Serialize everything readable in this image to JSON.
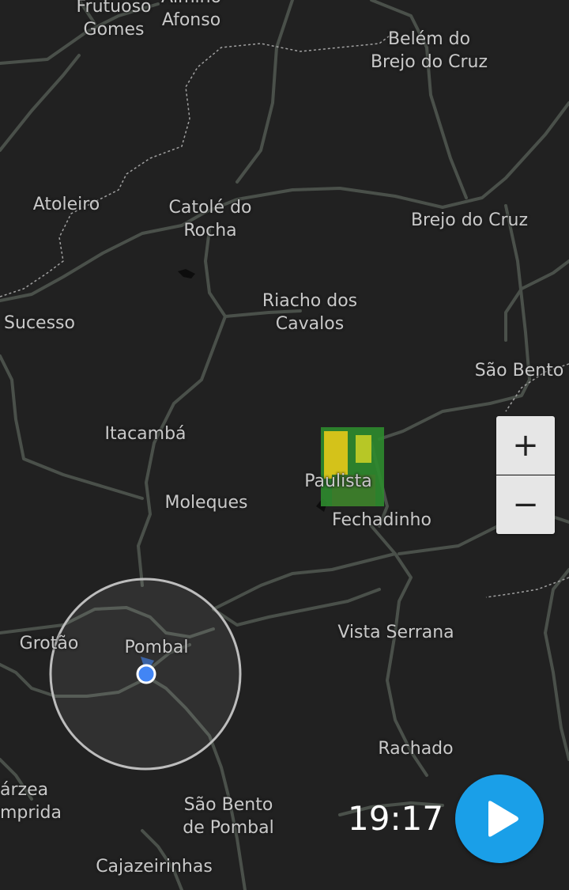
{
  "map": {
    "places": {
      "frutuoso_gomes": [
        "Frutuoso",
        "Gomes"
      ],
      "almino_afonso": [
        "Almino",
        "Afonso"
      ],
      "belem_do_brejo_do_cruz": [
        "Belém do",
        "Brejo do Cruz"
      ],
      "atoleiro": [
        "Atoleiro"
      ],
      "catole_do_rocha": [
        "Catolé do",
        "Rocha"
      ],
      "brejo_do_cruz": [
        "Brejo do Cruz"
      ],
      "riacho_dos_cavalos": [
        "Riacho dos",
        "Cavalos"
      ],
      "sucesso": [
        "Sucesso"
      ],
      "sao_bento": [
        "São Bento"
      ],
      "itacamba": [
        "Itacambá"
      ],
      "paulista": [
        "Paulista"
      ],
      "moleques": [
        "Moleques"
      ],
      "fechadinho": [
        "Fechadinho"
      ],
      "vista_serrana": [
        "Vista Serrana"
      ],
      "grotao": [
        "Grotão"
      ],
      "pombal": [
        "Pombal"
      ],
      "rachado": [
        "Rachado"
      ],
      "varzea_comprida": [
        "árzea",
        "mprida"
      ],
      "sao_bento_de_pombal": [
        "São Bento",
        "de Pombal"
      ],
      "cajazeirinhas": [
        "Cajazeirinhas"
      ]
    },
    "location_marker": {
      "color": "#4285f4"
    }
  },
  "controls": {
    "zoom_in": "+",
    "zoom_out": "−",
    "time": "19:17",
    "play_icon": "play-icon"
  },
  "colors": {
    "background": "#212121",
    "road": "#4a504a",
    "border": "#bdbdbd",
    "accent": "#1a9fe8",
    "radar_green": "#2e8b2e",
    "radar_yellow": "#d4c21a"
  }
}
